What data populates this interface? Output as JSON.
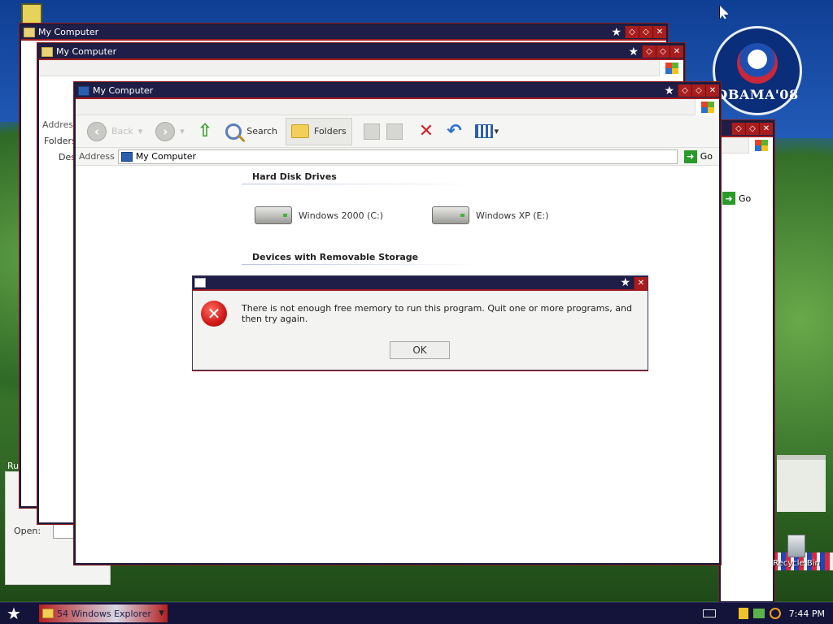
{
  "windows": {
    "back1_title": "My Computer",
    "back2_title": "My Computer",
    "main_title": "My Computer"
  },
  "toolbar": {
    "back_label": "Back",
    "search_label": "Search",
    "folders_label": "Folders"
  },
  "address": {
    "label": "Address",
    "value": "My Computer",
    "go_label": "Go"
  },
  "back_window": {
    "address_label": "Address",
    "folders_label": "Folders",
    "tree_desktop": "Desk"
  },
  "sections": {
    "hard_disk": "Hard Disk Drives",
    "removable": "Devices with Removable Storage"
  },
  "drives": [
    {
      "label": "Windows 2000 (C:)"
    },
    {
      "label": "Windows XP (E:)"
    }
  ],
  "dialog": {
    "message": "There is not enough free memory to run this program. Quit one or more programs, and then try again.",
    "ok_label": "OK"
  },
  "taskbar": {
    "task_label": "54 Windows Explorer",
    "clock": "7:44 PM"
  },
  "desktop": {
    "recycle_label": "Recycle Bin",
    "badge_text": "OBAMA'08",
    "run_title": "Run",
    "run_open_label": "Open:"
  },
  "colors": {
    "titlebar": "#1e1e48",
    "close_button": "#a81d1d",
    "taskbar": "#14143a"
  }
}
